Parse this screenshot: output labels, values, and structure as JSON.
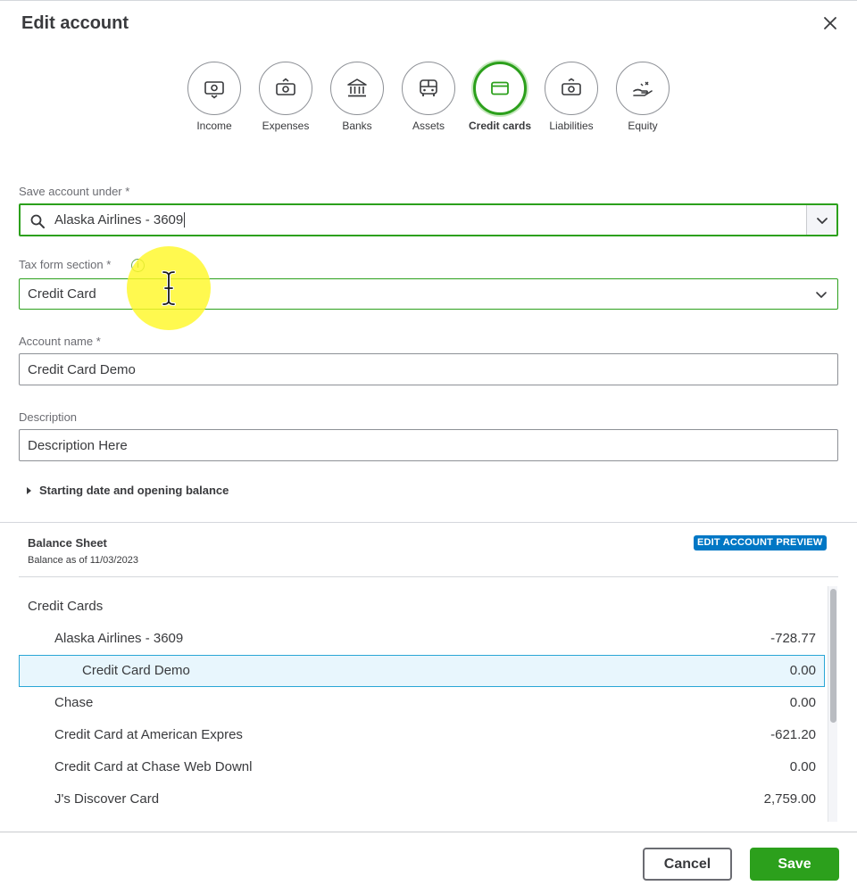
{
  "dialog": {
    "title": "Edit account"
  },
  "account_types": [
    {
      "key": "income",
      "label": "Income",
      "icon": "money-icon"
    },
    {
      "key": "expenses",
      "label": "Expenses",
      "icon": "money-bag-icon"
    },
    {
      "key": "banks",
      "label": "Banks",
      "icon": "bank-icon"
    },
    {
      "key": "assets",
      "label": "Assets",
      "icon": "vehicle-icon"
    },
    {
      "key": "credit_cards",
      "label": "Credit cards",
      "icon": "credit-card-icon",
      "active": true
    },
    {
      "key": "liabilities",
      "label": "Liabilities",
      "icon": "money-icon"
    },
    {
      "key": "equity",
      "label": "Equity",
      "icon": "hand-coin-icon"
    }
  ],
  "form": {
    "save_under_label": "Save account under *",
    "save_under_value": "Alaska Airlines - 3609",
    "tax_label": "Tax form section *",
    "tax_info_glyph": "i",
    "tax_value": "Credit Card",
    "name_label": "Account name *",
    "name_value": "Credit Card Demo",
    "desc_label": "Description",
    "desc_value": "Description Here",
    "expander_label": "Starting date and opening balance"
  },
  "balance_sheet": {
    "title": "Balance Sheet",
    "subtitle": "Balance as of 11/03/2023",
    "badge": "EDIT ACCOUNT PREVIEW",
    "rows": [
      {
        "name": "Credit Cards",
        "amount": "",
        "indent": 0
      },
      {
        "name": "Alaska Airlines - 3609",
        "amount": "-728.77",
        "indent": 1
      },
      {
        "name": "Credit Card Demo",
        "amount": "0.00",
        "indent": 2,
        "highlight": true
      },
      {
        "name": "Chase",
        "amount": "0.00",
        "indent": 1
      },
      {
        "name": "Credit Card at American Expres",
        "amount": "-621.20",
        "indent": 1
      },
      {
        "name": "Credit Card at Chase Web Downl",
        "amount": "0.00",
        "indent": 1
      },
      {
        "name": "J's Discover Card",
        "amount": "2,759.00",
        "indent": 1
      }
    ]
  },
  "footer": {
    "cancel_label": "Cancel",
    "save_label": "Save"
  },
  "colors": {
    "accent_green": "#2ca01c",
    "badge_blue": "#0077c5",
    "row_highlight": "#e8f6fd"
  }
}
